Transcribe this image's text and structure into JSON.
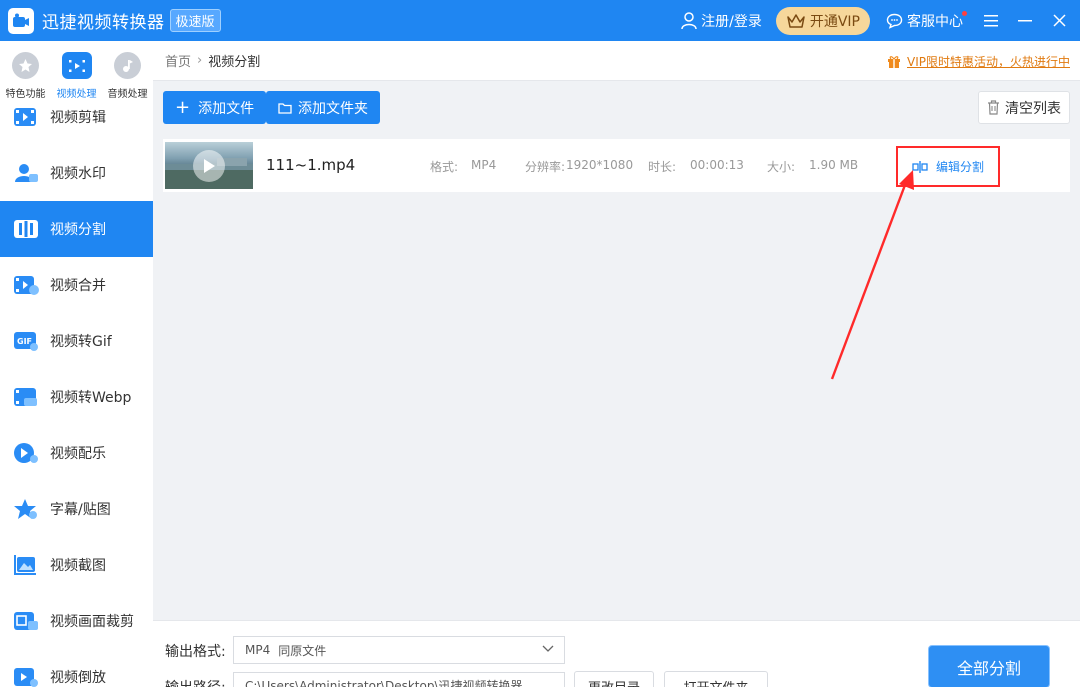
{
  "window": {
    "title": "迅捷视频转换器",
    "edition": "极速版",
    "login": "注册/登录",
    "vip": "开通VIP",
    "support": "客服中心"
  },
  "sidebar": {
    "tabs": [
      {
        "label": "特色功能",
        "icon": "star-icon"
      },
      {
        "label": "视频处理",
        "icon": "film-icon",
        "active": true
      },
      {
        "label": "音频处理",
        "icon": "music-icon"
      }
    ],
    "items": [
      {
        "label": "视频剪辑",
        "icon": "video-cut-icon"
      },
      {
        "label": "视频水印",
        "icon": "watermark-icon"
      },
      {
        "label": "视频分割",
        "icon": "split-icon",
        "active": true
      },
      {
        "label": "视频合并",
        "icon": "merge-icon"
      },
      {
        "label": "视频转Gif",
        "icon": "gif-icon"
      },
      {
        "label": "视频转Webp",
        "icon": "webp-icon"
      },
      {
        "label": "视频配乐",
        "icon": "music-video-icon"
      },
      {
        "label": "字幕/贴图",
        "icon": "sticker-icon"
      },
      {
        "label": "视频截图",
        "icon": "screenshot-icon"
      },
      {
        "label": "视频画面裁剪",
        "icon": "crop-icon"
      },
      {
        "label": "视频倒放",
        "icon": "reverse-icon"
      }
    ]
  },
  "breadcrumb": {
    "home": "首页",
    "current": "视频分割"
  },
  "promo": "VIP限时特惠活动，火热进行中",
  "toolbar": {
    "add_file": "添加文件",
    "add_folder": "添加文件夹",
    "clear_list": "清空列表"
  },
  "file": {
    "name": "111~1.mp4",
    "format_label": "格式:",
    "format": "MP4",
    "resolution_label": "分辨率:",
    "resolution": "1920*1080",
    "duration_label": "时长:",
    "duration": "00:00:13",
    "size_label": "大小:",
    "size": "1.90 MB",
    "edit_label": "编辑分割"
  },
  "output": {
    "format_label": "输出格式:",
    "format_value": "MP4",
    "format_option": "同原文件",
    "path_label": "输出路径:",
    "path_value": "C:\\Users\\Administrator\\Desktop\\迅捷视频转换器",
    "change_dir": "更改目录",
    "open_folder": "打开文件夹",
    "split_all": "全部分割"
  },
  "colors": {
    "brand": "#1f86f2",
    "vip": "#f6d79b",
    "highlight": "#ff2a2a"
  }
}
